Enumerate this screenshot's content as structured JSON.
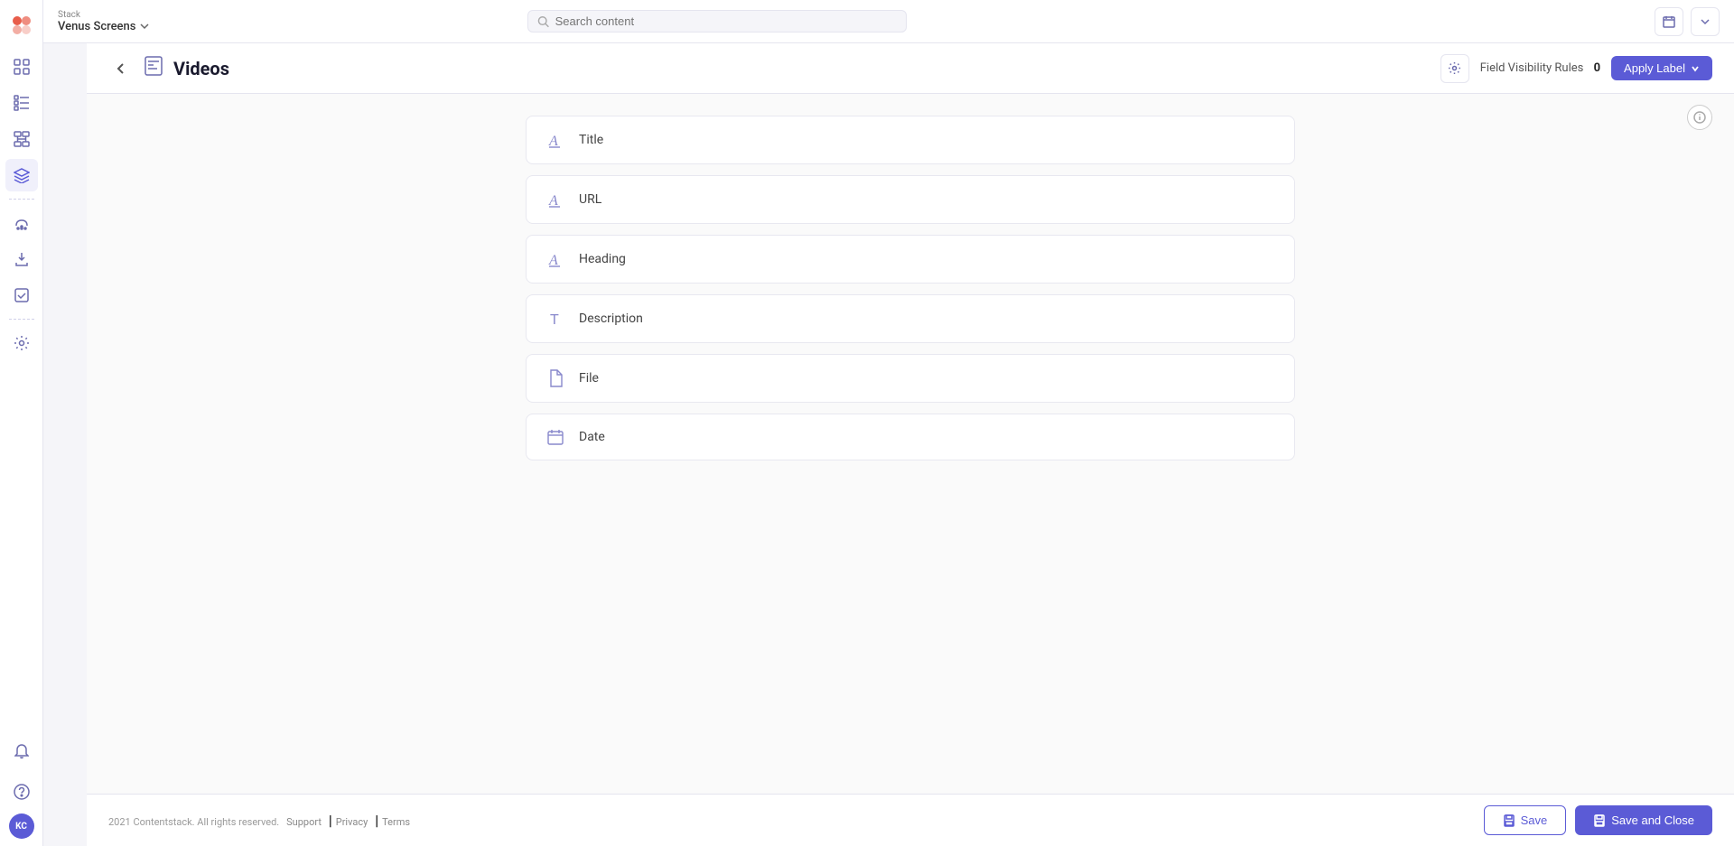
{
  "app": {
    "name": "Stack",
    "workspace": "Venus Screens"
  },
  "topbar": {
    "search_placeholder": "Search content",
    "stack_label": "Stack",
    "workspace_name": "Venus Screens"
  },
  "header": {
    "title": "Videos",
    "field_visibility_label": "Field Visibility Rules",
    "field_visibility_count": "0",
    "apply_label_btn": "Apply Label"
  },
  "fields": [
    {
      "id": "title",
      "label": "Title",
      "type": "text"
    },
    {
      "id": "url",
      "label": "URL",
      "type": "text"
    },
    {
      "id": "heading",
      "label": "Heading",
      "type": "text"
    },
    {
      "id": "description",
      "label": "Description",
      "type": "paragraph"
    },
    {
      "id": "file",
      "label": "File",
      "type": "file"
    },
    {
      "id": "date",
      "label": "Date",
      "type": "date"
    }
  ],
  "footer": {
    "copyright": "2021 Contentstack. All rights reserved.",
    "support_label": "Support",
    "privacy_label": "Privacy",
    "terms_label": "Terms",
    "save_label": "Save",
    "save_close_label": "Save and Close"
  },
  "sidebar": {
    "items": [
      {
        "id": "dashboard",
        "icon": "⊞",
        "label": "Dashboard"
      },
      {
        "id": "entries",
        "icon": "≡",
        "label": "Entries"
      },
      {
        "id": "content-types",
        "icon": "⊟",
        "label": "Content Types"
      },
      {
        "id": "stack",
        "icon": "◧",
        "label": "Stack",
        "active": true
      }
    ],
    "bottom_items": [
      {
        "id": "notifications",
        "icon": "🔔",
        "label": "Notifications"
      },
      {
        "id": "help",
        "icon": "?",
        "label": "Help"
      }
    ],
    "user_initials": "KC"
  }
}
